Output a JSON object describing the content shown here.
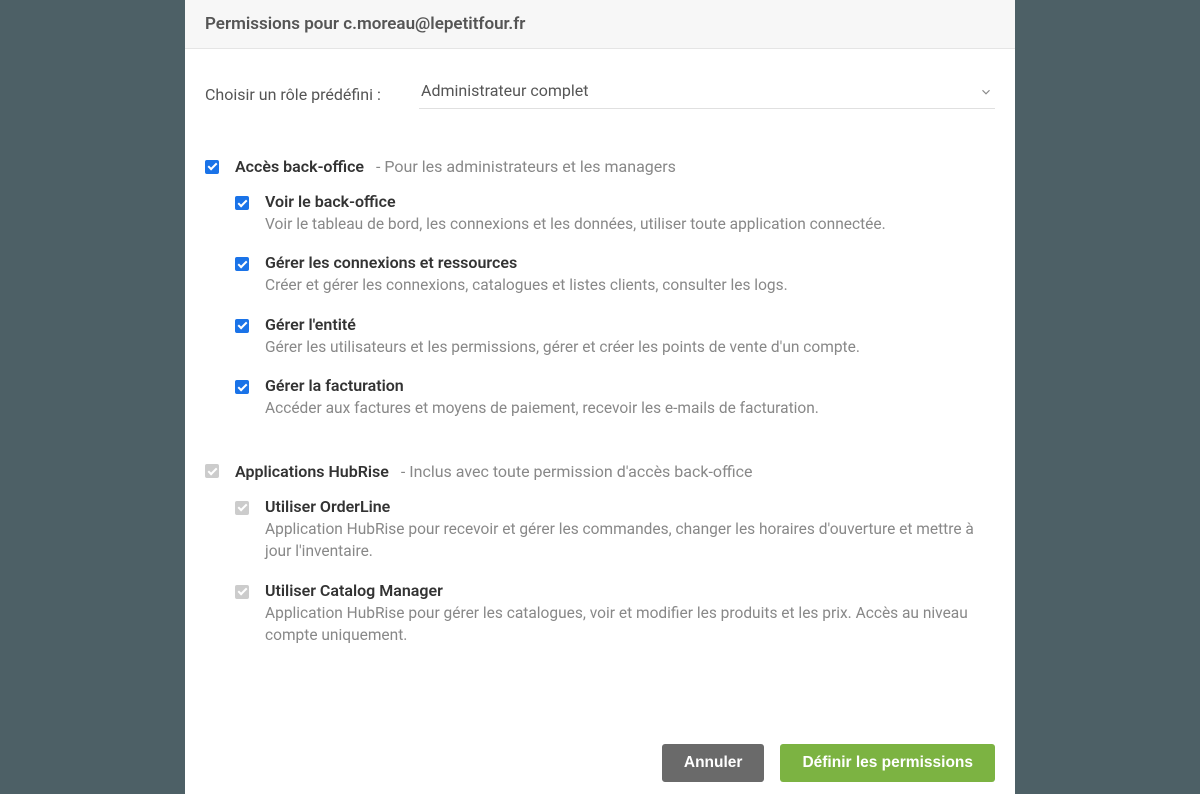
{
  "header": {
    "title": "Permissions pour c.moreau@lepetitfour.fr"
  },
  "role": {
    "label": "Choisir un rôle prédéfini :",
    "value": "Administrateur complet"
  },
  "sections": [
    {
      "title": "Accès back-office",
      "subtitle": "  -   Pour les administrateurs et les managers",
      "checked": true,
      "disabled": false,
      "perms": [
        {
          "title": "Voir le back-office",
          "desc": "Voir le tableau de bord, les connexions et les données, utiliser toute application connectée.",
          "checked": true,
          "disabled": false
        },
        {
          "title": "Gérer les connexions et ressources",
          "desc": "Créer et gérer les connexions, catalogues et listes clients, consulter les logs.",
          "checked": true,
          "disabled": false
        },
        {
          "title": "Gérer l'entité",
          "desc": "Gérer les utilisateurs et les permissions, gérer et créer les points de vente d'un compte.",
          "checked": true,
          "disabled": false
        },
        {
          "title": "Gérer la facturation",
          "desc": "Accéder aux factures et moyens de paiement, recevoir les e-mails de facturation.",
          "checked": true,
          "disabled": false
        }
      ]
    },
    {
      "title": "Applications HubRise",
      "subtitle": "  -   Inclus avec toute permission d'accès back-office",
      "checked": true,
      "disabled": true,
      "perms": [
        {
          "title": "Utiliser OrderLine",
          "desc": "Application HubRise pour recevoir et gérer les commandes, changer les horaires d'ouverture et mettre à jour l'inventaire.",
          "checked": true,
          "disabled": true
        },
        {
          "title": "Utiliser Catalog Manager",
          "desc": "Application HubRise pour gérer les catalogues, voir et modifier les produits et les prix. Accès au niveau compte uniquement.",
          "checked": true,
          "disabled": true
        }
      ]
    }
  ],
  "footer": {
    "cancel": "Annuler",
    "submit": "Définir les permissions"
  }
}
